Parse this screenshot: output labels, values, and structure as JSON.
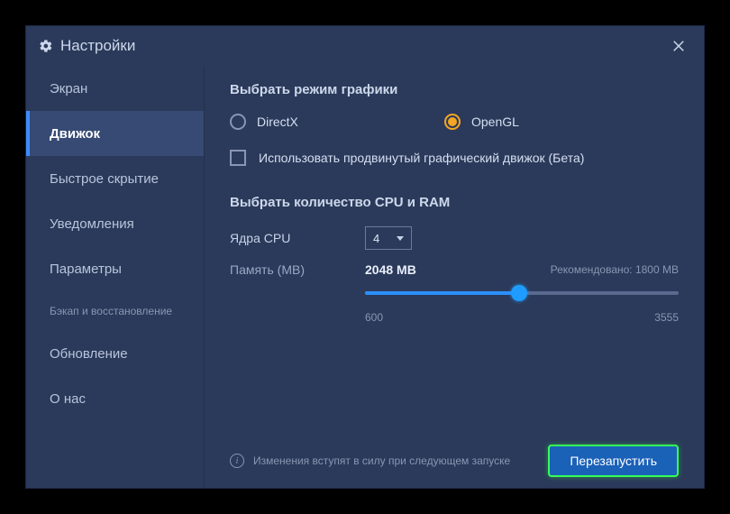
{
  "title": "Настройки",
  "sidebar": {
    "items": [
      {
        "label": "Экран"
      },
      {
        "label": "Движок"
      },
      {
        "label": "Быстрое скрытие"
      },
      {
        "label": "Уведомления"
      },
      {
        "label": "Параметры"
      },
      {
        "label": "Бэкап и восстановление"
      },
      {
        "label": "Обновление"
      },
      {
        "label": "О нас"
      }
    ]
  },
  "engine": {
    "graphics_mode_title": "Выбрать режим графики",
    "directx_label": "DirectX",
    "opengl_label": "OpenGL",
    "advanced_engine_label": "Использовать продвинутый графический движок (Бета)",
    "cpu_ram_title": "Выбрать количество CPU и RAM",
    "cpu_cores_label": "Ядра CPU",
    "cpu_cores_value": "4",
    "memory_label": "Память (MB)",
    "memory_value": "2048 MB",
    "recommended_label": "Рекомендовано: 1800 MB",
    "slider_min": "600",
    "slider_max": "3555"
  },
  "footer": {
    "info_text": "Изменения вступят в силу при следующем запуске",
    "restart_label": "Перезапустить"
  }
}
